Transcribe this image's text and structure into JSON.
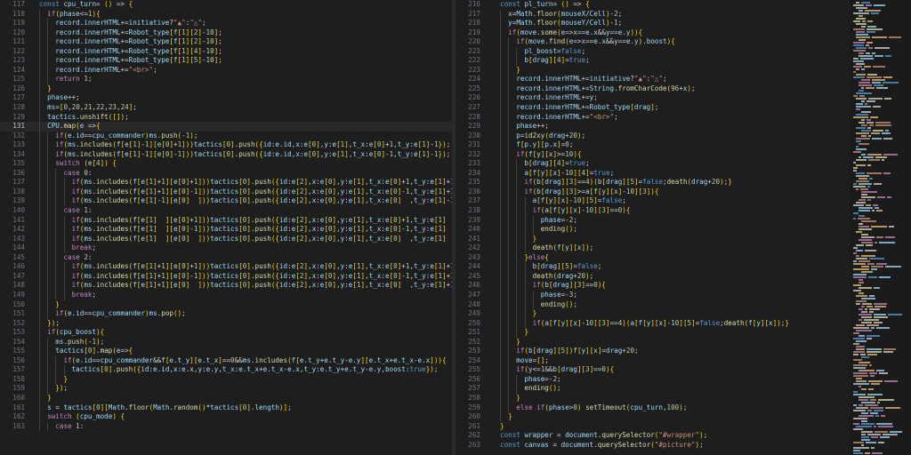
{
  "editor_left": {
    "active_line": "131",
    "lines": [
      {
        "num": "117",
        "text": "const cpu_turn= () => {"
      },
      {
        "num": "118",
        "text": "  if(phase<=1){"
      },
      {
        "num": "119",
        "text": "    record.innerHTML+=initiative?\"▲\":\"△\";"
      },
      {
        "num": "120",
        "text": "    record.innerHTML+=Robot_type[f[1][2]-10];"
      },
      {
        "num": "121",
        "text": "    record.innerHTML+=Robot_type[f[1][2]-10];"
      },
      {
        "num": "122",
        "text": "    record.innerHTML+=Robot_type[f[1][4]-10];"
      },
      {
        "num": "123",
        "text": "    record.innerHTML+=Robot_type[f[1][5]-10];"
      },
      {
        "num": "124",
        "text": "    record.innerHTML+=\"<br>\";"
      },
      {
        "num": "125",
        "text": "    return 1;"
      },
      {
        "num": "126",
        "text": "  }"
      },
      {
        "num": "127",
        "text": "  phase++;"
      },
      {
        "num": "128",
        "text": "  ms=[0,20,21,22,23,24];"
      },
      {
        "num": "129",
        "text": "  tactics.unshift([]);"
      },
      {
        "num": "131",
        "text": "  CPU.map(e =>{"
      },
      {
        "num": "132",
        "text": "    if(e.id==cpu_commander)ms.push(-1);"
      },
      {
        "num": "133",
        "text": "    if(ms.includes(f[e[1]-1][e[0]+1]))tactics[0].push({id:e.id,x:e[0],y:e[1],t_x:e[0]+1,t_y:e[1]-1});"
      },
      {
        "num": "134",
        "text": "    if(ms.includes(f[e[1]-1][e[0]-1]))tactics[0].push({id:e.id,x:e[0],y:e[1],t_x:e[0]-1,t_y:e[1]-1});"
      },
      {
        "num": "135",
        "text": "    switch (e[4]) {"
      },
      {
        "num": "136",
        "text": "      case 0:"
      },
      {
        "num": "137",
        "text": "        if(ms.includes(f[e[1]+1][e[0]+1]))tactics[0].push({id:e[2],x:e[0],y:e[1],t_x:e[0]+1,t_y:e[1]+1});"
      },
      {
        "num": "138",
        "text": "        if(ms.includes(f[e[1]+1][e[0]-1]))tactics[0].push({id:e[2],x:e[0],y:e[1],t_x:e[0]-1,t_y:e[1]+1});"
      },
      {
        "num": "139",
        "text": "        if(ms.includes(f[e[1]-1][e[0]  ]))tactics[0].push({id:e[2],x:e[0],y:e[1],t_x:e[0]  ,t_y:e[1]-1});"
      },
      {
        "num": "140",
        "text": "      case 1:"
      },
      {
        "num": "141",
        "text": "        if(ms.includes(f[e[1]  ][e[0]+1]))tactics[0].push({id:e[2],x:e[0],y:e[1],t_x:e[0]+1,t_y:e[1]  });"
      },
      {
        "num": "142",
        "text": "        if(ms.includes(f[e[1]  ][e[0]-1]))tactics[0].push({id:e[2],x:e[0],y:e[1],t_x:e[0]-1,t_y:e[1]  });"
      },
      {
        "num": "143",
        "text": "        if(ms.includes(f[e[1]  ][e[0]  ]))tactics[0].push({id:e[2],x:e[0],y:e[1],t_x:e[0]  ,t_y:e[1]  });"
      },
      {
        "num": "144",
        "text": "        break;"
      },
      {
        "num": "145",
        "text": "      case 2:"
      },
      {
        "num": "146",
        "text": "        if(ms.includes(f[e[1]+1][e[0]+1]))tactics[0].push({id:e[2],x:e[0],y:e[1],t_x:e[0]+1,t_y:e[1]+1});"
      },
      {
        "num": "147",
        "text": "        if(ms.includes(f[e[1]+1][e[0]-1]))tactics[0].push({id:e[2],x:e[0],y:e[1],t_x:e[0]-1,t_y:e[1]+1});"
      },
      {
        "num": "148",
        "text": "        if(ms.includes(f[e[1]+1][e[0]  ]))tactics[0].push({id:e[2],x:e[0],y:e[1],t_x:e[0]  ,t_y:e[1]+1});"
      },
      {
        "num": "149",
        "text": "        break;"
      },
      {
        "num": "150",
        "text": "    }"
      },
      {
        "num": "151",
        "text": "    if(e.id==cpu_commander)ms.pop();"
      },
      {
        "num": "152",
        "text": "  });"
      },
      {
        "num": "153",
        "text": "  if(cpu_boost){"
      },
      {
        "num": "154",
        "text": "    ms.push(-1);"
      },
      {
        "num": "155",
        "text": "    tactics[0].map(e=>{"
      },
      {
        "num": "156",
        "text": "      if(e.id==cpu_commander&&f[e.t_y][e.t_x]==0&&ms.includes(f[e.t_y+e.t_y-e.y][e.t_x+e.t_x-e.x])){"
      },
      {
        "num": "157",
        "text": "        tactics[0].push({id:e.id,x:e.x,y:e.y,t_x:e.t_x+e.t_x-e.x,t_y:e.t_y+e.t_y-e.y,boost:true});"
      },
      {
        "num": "158",
        "text": "      }"
      },
      {
        "num": "159",
        "text": "    });"
      },
      {
        "num": "160",
        "text": "  }"
      },
      {
        "num": "161",
        "text": "  s = tactics[0][Math.floor(Math.random()*tactics[0].length)];"
      },
      {
        "num": "162",
        "text": "  switch (cpu_mode) {"
      },
      {
        "num": "163",
        "text": "    case 1:"
      }
    ]
  },
  "editor_right": {
    "lines": [
      {
        "num": "216",
        "text": "const pl_turn= () => {"
      },
      {
        "num": "217",
        "text": "  x=Math.floor(mouseX/Cell)-2;"
      },
      {
        "num": "218",
        "text": "  y=Math.floor(mouseY/Cell)-1;"
      },
      {
        "num": "219",
        "text": "  if(move.some(e=>x==e.x&&y==e.y)){"
      },
      {
        "num": "220",
        "text": "    if(move.find(e=>x==e.x&&y==e.y).boost){"
      },
      {
        "num": "221",
        "text": "      pl_boost=false;"
      },
      {
        "num": "222",
        "text": "      b[drag][4]=true;"
      },
      {
        "num": "223",
        "text": "    }"
      },
      {
        "num": "224",
        "text": "    record.innerHTML+=initiative?\"▲\":\"△\";"
      },
      {
        "num": "225",
        "text": "    record.innerHTML+=String.fromCharCode(96+x);"
      },
      {
        "num": "226",
        "text": "    record.innerHTML+=y;"
      },
      {
        "num": "227",
        "text": "    record.innerHTML+=Robot_type[drag];"
      },
      {
        "num": "228",
        "text": "    record.innerHTML+=\"<br>\";"
      },
      {
        "num": "229",
        "text": "    phase++;"
      },
      {
        "num": "230",
        "text": "    p=id2xy(drag+20);"
      },
      {
        "num": "231",
        "text": "    f[p.y][p.x]=0;"
      },
      {
        "num": "232",
        "text": "    if(f[y][x]>=10){"
      },
      {
        "num": "233",
        "text": "      b[drag][4]=true;"
      },
      {
        "num": "234",
        "text": "      a[f[y][x]-10][4]=true;"
      },
      {
        "num": "235",
        "text": "      if(b[drag][3]==4)(b[drag][5]=false;death(drag+20);}"
      },
      {
        "num": "236",
        "text": "      if(b[drag][3]>=a[f[y][x]-10][3]){"
      },
      {
        "num": "237",
        "text": "        a[f[y][x]-10][5]=false;"
      },
      {
        "num": "238",
        "text": "        if(a[f[y][x]-10][3]==0){"
      },
      {
        "num": "239",
        "text": "          phase=-2;"
      },
      {
        "num": "240",
        "text": "          ending();"
      },
      {
        "num": "241",
        "text": "        }"
      },
      {
        "num": "242",
        "text": "        death(f[y][x]);"
      },
      {
        "num": "243",
        "text": "      }else{"
      },
      {
        "num": "244",
        "text": "        b[drag][5]=false;"
      },
      {
        "num": "245",
        "text": "        death(drag+20);"
      },
      {
        "num": "246",
        "text": "        if(b[drag][3]==0){"
      },
      {
        "num": "247",
        "text": "          phase=-3;"
      },
      {
        "num": "248",
        "text": "          ending();"
      },
      {
        "num": "249",
        "text": "        }"
      },
      {
        "num": "250",
        "text": "        if(a[f[y][x]-10][3]==4)(a[f[y][x]-10][5]=false;death(f[y][x]);}"
      },
      {
        "num": "251",
        "text": "      }"
      },
      {
        "num": "252",
        "text": "    }"
      },
      {
        "num": "253",
        "text": "    if(b[drag][5])f[y][x]=drag+20;"
      },
      {
        "num": "254",
        "text": "    move=[];"
      },
      {
        "num": "255",
        "text": "    if(y<=1&&b[drag][3]==0){"
      },
      {
        "num": "256",
        "text": "      phase=-2;"
      },
      {
        "num": "257",
        "text": "      ending();"
      },
      {
        "num": "258",
        "text": "    }"
      },
      {
        "num": "259",
        "text": "    else if(phase>0) setTimeout(cpu_turn,100);"
      },
      {
        "num": "260",
        "text": "  }"
      },
      {
        "num": "261",
        "text": "}"
      },
      {
        "num": "262",
        "text": "const wrapper = document.querySelector(\"#wrapper\");"
      },
      {
        "num": "263",
        "text": "const canvas = document.querySelector(\"#picture\");"
      }
    ]
  },
  "colors": {
    "background": "#1e1e1e",
    "text": "#d4d4d4",
    "keyword": "#569cd6",
    "control": "#c586c0",
    "function": "#dcdcaa",
    "variable": "#9cdcfe",
    "number": "#b5cea8",
    "string": "#ce9178",
    "bracket": "#ffd700",
    "line_number": "#6e7681",
    "minimap_accent": "#e5c07b"
  }
}
